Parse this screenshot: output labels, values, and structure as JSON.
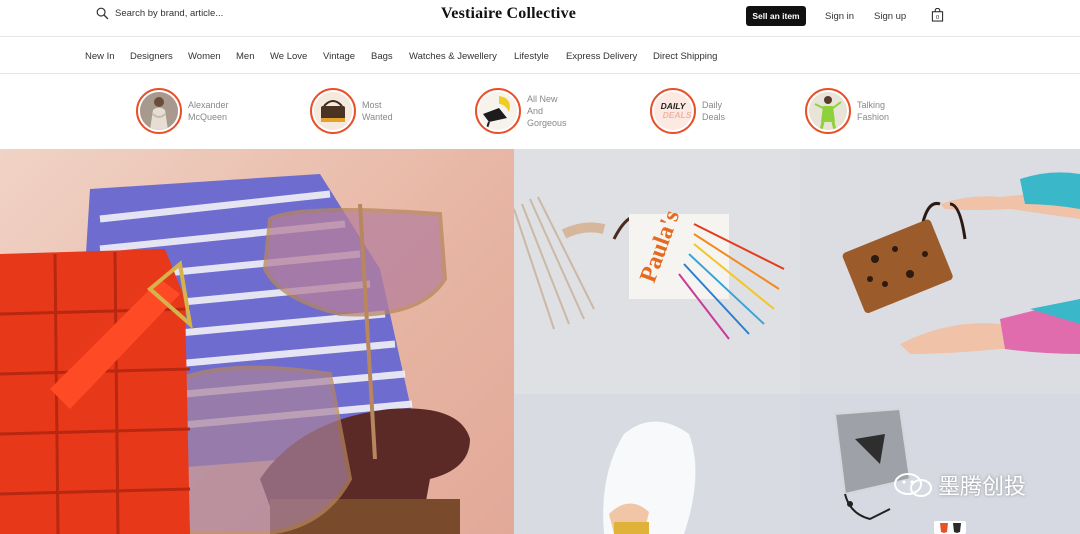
{
  "header": {
    "search_placeholder": "Search by brand, article...",
    "logo": "Vestiaire Collective",
    "sell_label": "Sell an item",
    "signin_label": "Sign in",
    "signup_label": "Sign up"
  },
  "nav": {
    "items": [
      "New In",
      "Designers",
      "Women",
      "Men",
      "We Love",
      "Vintage",
      "Bags",
      "Watches & Jewellery",
      "Lifestyle",
      "Express Delivery",
      "Direct Shipping"
    ]
  },
  "stories": [
    {
      "line1": "Alexander",
      "line2": "McQueen",
      "line3": ""
    },
    {
      "line1": "Most",
      "line2": "Wanted",
      "line3": ""
    },
    {
      "line1": "All New",
      "line2": "And",
      "line3": "Gorgeous"
    },
    {
      "line1": "Daily",
      "line2": "Deals",
      "line3": ""
    },
    {
      "line1": "Talking",
      "line2": "Fashion",
      "line3": ""
    }
  ],
  "daily_deals_badge": {
    "line1": "DAILY",
    "line2": "DEALS"
  },
  "hero": {
    "bag_text": "Paula's"
  },
  "watermark": {
    "text": "墨腾创投"
  },
  "colors": {
    "accent": "#e8502a",
    "sell_button_bg": "#111111"
  }
}
